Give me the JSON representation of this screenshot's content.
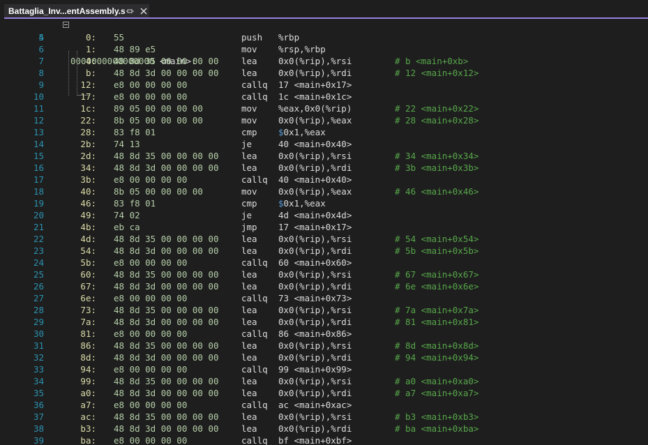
{
  "tab": {
    "title": "Battaglia_Inv...entAssembly.s",
    "pin_icon": "pin-icon",
    "close_icon": "close-icon"
  },
  "header": {
    "line": "4",
    "address": "0000000000000000",
    "label": " <main>:"
  },
  "rows": [
    {
      "ln": "5",
      "addr": "0:",
      "bytes": "55",
      "mnem": "push",
      "ops": "%rbp",
      "cmt": ""
    },
    {
      "ln": "6",
      "addr": "1:",
      "bytes": "48 89 e5",
      "mnem": "mov",
      "ops": "%rsp,%rbp",
      "cmt": ""
    },
    {
      "ln": "7",
      "addr": "4:",
      "bytes": "48 8d 35 00 00 00 00",
      "mnem": "lea",
      "ops": "0x0(%rip),%rsi",
      "cmt": "# b <main+0xb>"
    },
    {
      "ln": "8",
      "addr": "b:",
      "bytes": "48 8d 3d 00 00 00 00",
      "mnem": "lea",
      "ops": "0x0(%rip),%rdi",
      "cmt": "# 12 <main+0x12>"
    },
    {
      "ln": "9",
      "addr": "12:",
      "bytes": "e8 00 00 00 00",
      "mnem": "callq",
      "ops": "17 <main+0x17>",
      "cmt": ""
    },
    {
      "ln": "10",
      "addr": "17:",
      "bytes": "e8 00 00 00 00",
      "mnem": "callq",
      "ops": "1c <main+0x1c>",
      "cmt": ""
    },
    {
      "ln": "11",
      "addr": "1c:",
      "bytes": "89 05 00 00 00 00",
      "mnem": "mov",
      "ops": "%eax,0x0(%rip)",
      "cmt": "# 22 <main+0x22>"
    },
    {
      "ln": "12",
      "addr": "22:",
      "bytes": "8b 05 00 00 00 00",
      "mnem": "mov",
      "ops": "0x0(%rip),%eax",
      "cmt": "# 28 <main+0x28>"
    },
    {
      "ln": "13",
      "addr": "28:",
      "bytes": "83 f8 01",
      "mnem": "cmp",
      "ops": "$0x1,%eax",
      "cmt": ""
    },
    {
      "ln": "14",
      "addr": "2b:",
      "bytes": "74 13",
      "mnem": "je",
      "ops": "40 <main+0x40>",
      "cmt": ""
    },
    {
      "ln": "15",
      "addr": "2d:",
      "bytes": "48 8d 35 00 00 00 00",
      "mnem": "lea",
      "ops": "0x0(%rip),%rsi",
      "cmt": "# 34 <main+0x34>"
    },
    {
      "ln": "16",
      "addr": "34:",
      "bytes": "48 8d 3d 00 00 00 00",
      "mnem": "lea",
      "ops": "0x0(%rip),%rdi",
      "cmt": "# 3b <main+0x3b>"
    },
    {
      "ln": "17",
      "addr": "3b:",
      "bytes": "e8 00 00 00 00",
      "mnem": "callq",
      "ops": "40 <main+0x40>",
      "cmt": ""
    },
    {
      "ln": "18",
      "addr": "40:",
      "bytes": "8b 05 00 00 00 00",
      "mnem": "mov",
      "ops": "0x0(%rip),%eax",
      "cmt": "# 46 <main+0x46>"
    },
    {
      "ln": "19",
      "addr": "46:",
      "bytes": "83 f8 01",
      "mnem": "cmp",
      "ops": "$0x1,%eax",
      "cmt": ""
    },
    {
      "ln": "20",
      "addr": "49:",
      "bytes": "74 02",
      "mnem": "je",
      "ops": "4d <main+0x4d>",
      "cmt": ""
    },
    {
      "ln": "21",
      "addr": "4b:",
      "bytes": "eb ca",
      "mnem": "jmp",
      "ops": "17 <main+0x17>",
      "cmt": ""
    },
    {
      "ln": "22",
      "addr": "4d:",
      "bytes": "48 8d 35 00 00 00 00",
      "mnem": "lea",
      "ops": "0x0(%rip),%rsi",
      "cmt": "# 54 <main+0x54>"
    },
    {
      "ln": "23",
      "addr": "54:",
      "bytes": "48 8d 3d 00 00 00 00",
      "mnem": "lea",
      "ops": "0x0(%rip),%rdi",
      "cmt": "# 5b <main+0x5b>"
    },
    {
      "ln": "24",
      "addr": "5b:",
      "bytes": "e8 00 00 00 00",
      "mnem": "callq",
      "ops": "60 <main+0x60>",
      "cmt": ""
    },
    {
      "ln": "25",
      "addr": "60:",
      "bytes": "48 8d 35 00 00 00 00",
      "mnem": "lea",
      "ops": "0x0(%rip),%rsi",
      "cmt": "# 67 <main+0x67>"
    },
    {
      "ln": "26",
      "addr": "67:",
      "bytes": "48 8d 3d 00 00 00 00",
      "mnem": "lea",
      "ops": "0x0(%rip),%rdi",
      "cmt": "# 6e <main+0x6e>"
    },
    {
      "ln": "27",
      "addr": "6e:",
      "bytes": "e8 00 00 00 00",
      "mnem": "callq",
      "ops": "73 <main+0x73>",
      "cmt": ""
    },
    {
      "ln": "28",
      "addr": "73:",
      "bytes": "48 8d 35 00 00 00 00",
      "mnem": "lea",
      "ops": "0x0(%rip),%rsi",
      "cmt": "# 7a <main+0x7a>"
    },
    {
      "ln": "29",
      "addr": "7a:",
      "bytes": "48 8d 3d 00 00 00 00",
      "mnem": "lea",
      "ops": "0x0(%rip),%rdi",
      "cmt": "# 81 <main+0x81>"
    },
    {
      "ln": "30",
      "addr": "81:",
      "bytes": "e8 00 00 00 00",
      "mnem": "callq",
      "ops": "86 <main+0x86>",
      "cmt": ""
    },
    {
      "ln": "31",
      "addr": "86:",
      "bytes": "48 8d 35 00 00 00 00",
      "mnem": "lea",
      "ops": "0x0(%rip),%rsi",
      "cmt": "# 8d <main+0x8d>"
    },
    {
      "ln": "32",
      "addr": "8d:",
      "bytes": "48 8d 3d 00 00 00 00",
      "mnem": "lea",
      "ops": "0x0(%rip),%rdi",
      "cmt": "# 94 <main+0x94>"
    },
    {
      "ln": "33",
      "addr": "94:",
      "bytes": "e8 00 00 00 00",
      "mnem": "callq",
      "ops": "99 <main+0x99>",
      "cmt": ""
    },
    {
      "ln": "34",
      "addr": "99:",
      "bytes": "48 8d 35 00 00 00 00",
      "mnem": "lea",
      "ops": "0x0(%rip),%rsi",
      "cmt": "# a0 <main+0xa0>"
    },
    {
      "ln": "35",
      "addr": "a0:",
      "bytes": "48 8d 3d 00 00 00 00",
      "mnem": "lea",
      "ops": "0x0(%rip),%rdi",
      "cmt": "# a7 <main+0xa7>"
    },
    {
      "ln": "36",
      "addr": "a7:",
      "bytes": "e8 00 00 00 00",
      "mnem": "callq",
      "ops": "ac <main+0xac>",
      "cmt": ""
    },
    {
      "ln": "37",
      "addr": "ac:",
      "bytes": "48 8d 35 00 00 00 00",
      "mnem": "lea",
      "ops": "0x0(%rip),%rsi",
      "cmt": "# b3 <main+0xb3>"
    },
    {
      "ln": "38",
      "addr": "b3:",
      "bytes": "48 8d 3d 00 00 00 00",
      "mnem": "lea",
      "ops": "0x0(%rip),%rdi",
      "cmt": "# ba <main+0xba>"
    },
    {
      "ln": "39",
      "addr": "ba:",
      "bytes": "e8 00 00 00 00",
      "mnem": "callq",
      "ops": "bf <main+0xbf>",
      "cmt": ""
    }
  ]
}
